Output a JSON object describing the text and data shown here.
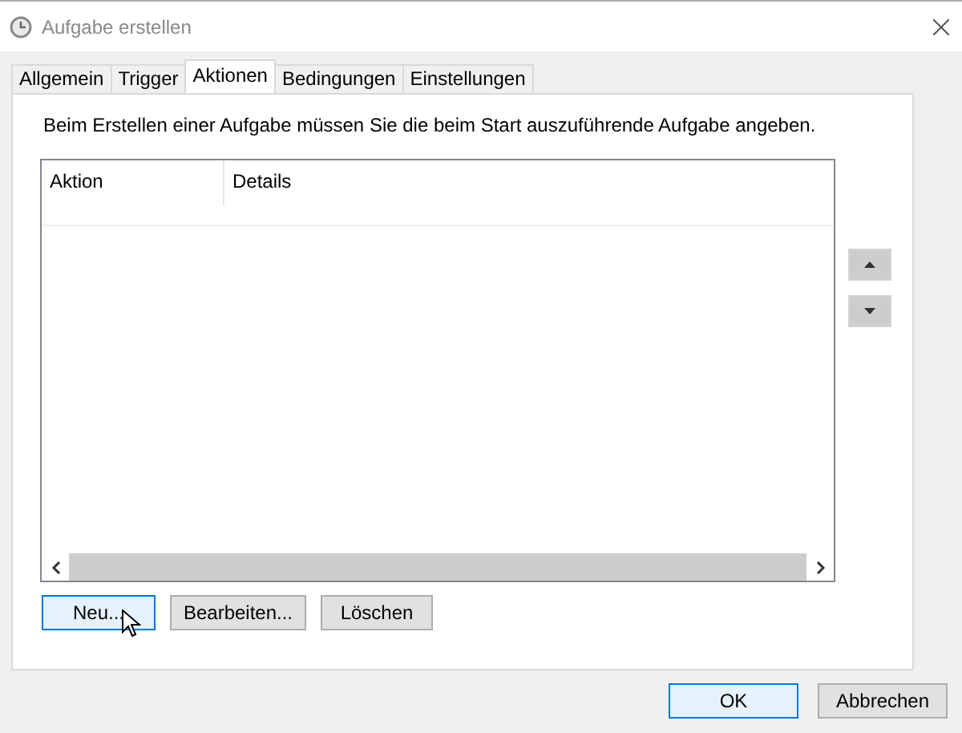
{
  "window": {
    "title": "Aufgabe erstellen"
  },
  "tabs": [
    {
      "label": "Allgemein",
      "selected": false
    },
    {
      "label": "Trigger",
      "selected": false
    },
    {
      "label": "Aktionen",
      "selected": true
    },
    {
      "label": "Bedingungen",
      "selected": false
    },
    {
      "label": "Einstellungen",
      "selected": false
    }
  ],
  "instruction": "Beim Erstellen einer Aufgabe müssen Sie die beim Start auszuführende Aufgabe angeben.",
  "table": {
    "columns": [
      "Aktion",
      "Details"
    ]
  },
  "action_buttons": [
    {
      "label": "Neu...",
      "focused": true
    },
    {
      "label": "Bearbeiten...",
      "focused": false
    },
    {
      "label": "Löschen",
      "focused": false
    }
  ],
  "dialog_buttons": [
    {
      "label": "OK",
      "focused": true
    },
    {
      "label": "Abbrechen",
      "focused": false
    }
  ]
}
